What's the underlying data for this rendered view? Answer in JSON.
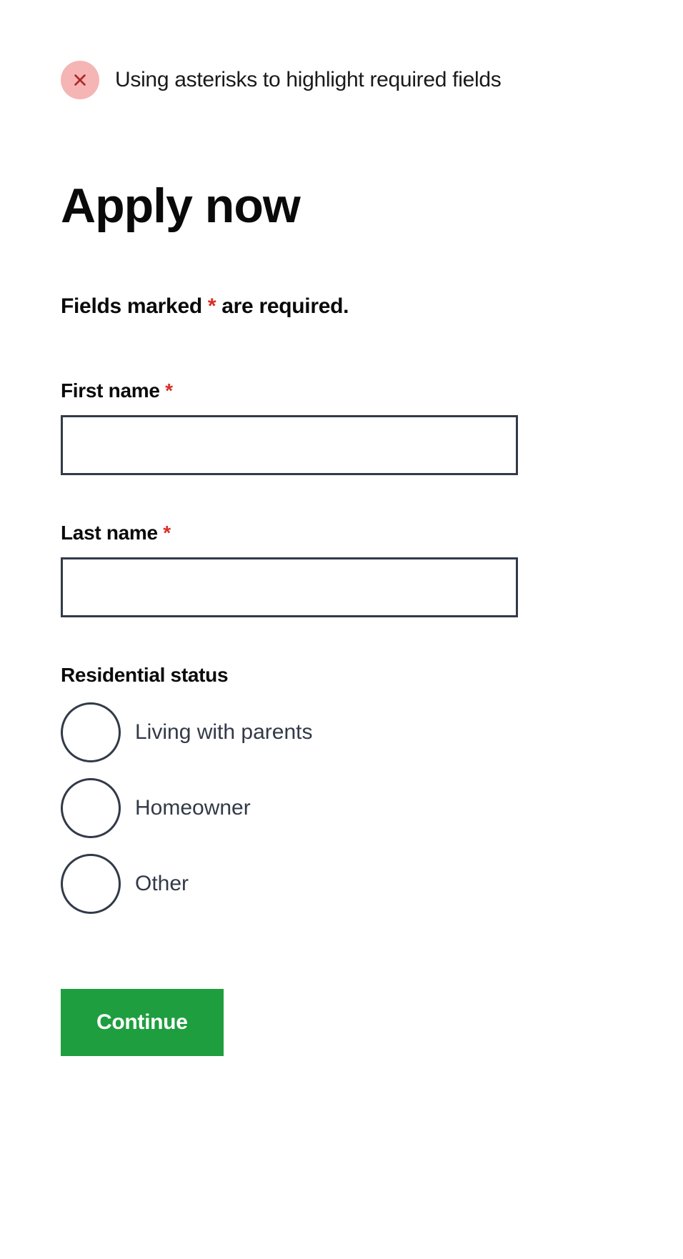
{
  "annotation": {
    "text": "Using asterisks to highlight required fields"
  },
  "title": "Apply now",
  "required_note": {
    "prefix": "Fields marked ",
    "marker": "*",
    "suffix": " are required."
  },
  "fields": {
    "first_name": {
      "label": "First name ",
      "marker": "*",
      "value": ""
    },
    "last_name": {
      "label": "Last name ",
      "marker": "*",
      "value": ""
    },
    "residential_status": {
      "label": "Residential status",
      "options": [
        "Living with parents",
        "Homeowner",
        "Other"
      ]
    }
  },
  "continue_label": "Continue"
}
